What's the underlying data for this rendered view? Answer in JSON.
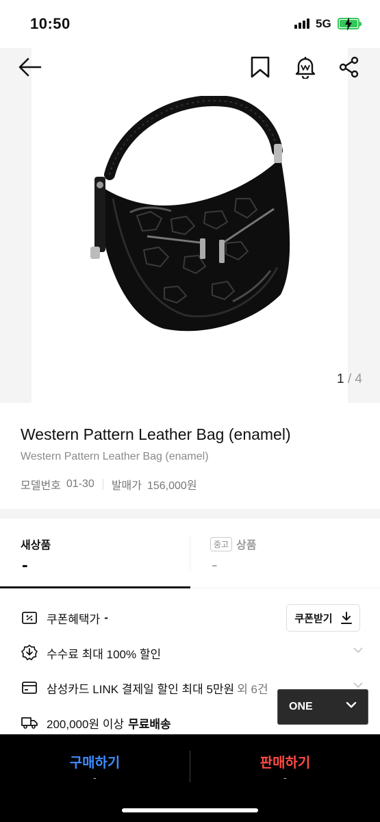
{
  "status": {
    "time": "10:50",
    "network": "5G"
  },
  "gallery": {
    "current": "1",
    "separator": "/",
    "total": "4"
  },
  "product": {
    "title": "Western Pattern Leather Bag (enamel)",
    "subtitle": "Western Pattern Leather Bag (enamel)",
    "model_label": "모델번호",
    "model_value": "01-30",
    "price_label": "발매가",
    "price_value": "156,000원"
  },
  "tabs": {
    "new": {
      "label": "새상품",
      "value": "-"
    },
    "used": {
      "badge": "중고",
      "label": "상품",
      "value": "-"
    }
  },
  "benefits": {
    "coupon_label": "쿠폰혜택가",
    "coupon_value": "-",
    "coupon_button": "쿠폰받기",
    "fee": "수수료 최대 100% 할인",
    "card": "삼성카드 LINK 결제일 할인 최대 5만원",
    "card_more": "외 6건",
    "shipping_prefix": "200,000원 이상",
    "shipping_bold": "무료배송"
  },
  "size_selector": {
    "value": "ONE"
  },
  "actions": {
    "buy": {
      "label": "구매하기",
      "price": "-"
    },
    "sell": {
      "label": "판매하기",
      "price": "-"
    }
  },
  "colors": {
    "buy": "#3d8bff",
    "sell": "#ff4a45",
    "battery": "#35c759"
  }
}
